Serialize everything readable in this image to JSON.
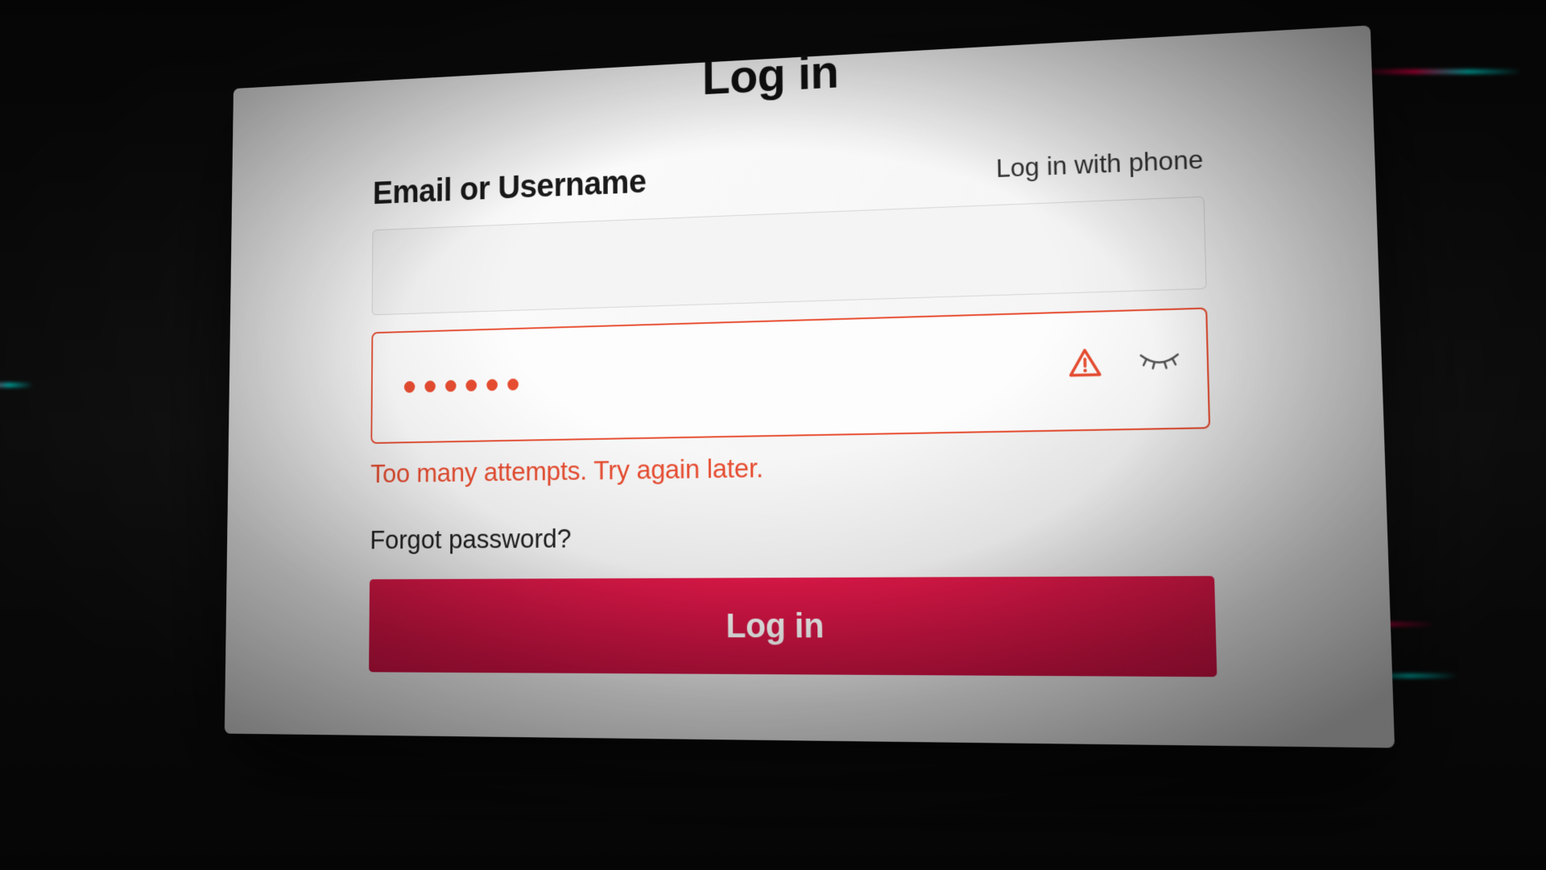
{
  "header": {
    "title": "Log in"
  },
  "form": {
    "field_label": "Email or Username",
    "alt_login": "Log in with phone",
    "email_value": "",
    "password_value": "••••••",
    "error_text": "Too many attempts. Try again later.",
    "forgot_text": "Forgot password?",
    "submit_label": "Log in"
  },
  "colors": {
    "error": "#e84d31",
    "primary": "#e3194a"
  }
}
